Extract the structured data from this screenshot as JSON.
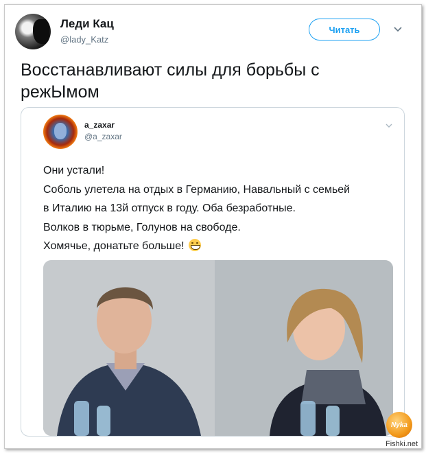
{
  "tweet": {
    "author_name": "Леди Кац",
    "author_handle": "@lady_Katz",
    "follow_label": "Читать",
    "text_line1": "Восстанавливают силы для борьбы с",
    "text_line2": "режЫмом"
  },
  "quoted_tweet": {
    "author_name": "a_zaxar",
    "author_handle": "@a_zaxar",
    "lines": [
      "Они устали!",
      "Соболь улетела на отдых в Германию, Навальный с семьей",
      "в Италию на 13й отпуск в году. Оба безработные.",
      "Волков в тюрьме, Голунов на свободе.",
      "Хомячье, донатьте больше!"
    ],
    "emoji": "grinning-face"
  },
  "icons": {
    "menu_caret": "chevron-down-icon",
    "quoted_caret": "chevron-down-icon"
  },
  "watermark": {
    "logo_text": "Nyka",
    "site": "Fishki.net"
  },
  "colors": {
    "accent": "#1da1f2",
    "secondary_text": "#657786",
    "border": "#ccd6dd"
  }
}
